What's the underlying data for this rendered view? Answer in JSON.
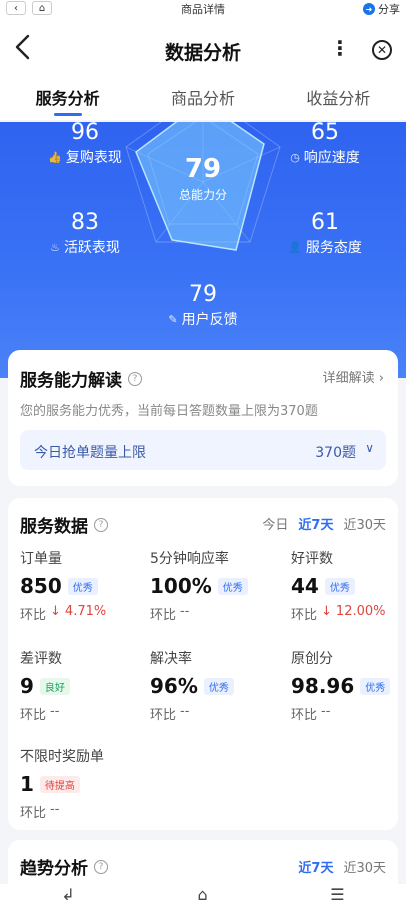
{
  "browser": {
    "title": "商品详情",
    "share_label": "分享",
    "back_icon": "chevron-left-icon",
    "home_icon": "home-icon"
  },
  "nav": {
    "title": "数据分析",
    "more": "⋮",
    "close": "✕"
  },
  "tabs": [
    {
      "label": "服务分析",
      "active": true
    },
    {
      "label": "商品分析",
      "active": false
    },
    {
      "label": "收益分析",
      "active": false
    }
  ],
  "radar": {
    "center": {
      "value": "79",
      "label": "总能力分"
    },
    "metrics": [
      {
        "value": "96",
        "label": "复购表现",
        "icon": "thumbs-up-icon"
      },
      {
        "value": "65",
        "label": "响应速度",
        "icon": "clock-icon"
      },
      {
        "value": "83",
        "label": "活跃表现",
        "icon": "flame-icon"
      },
      {
        "value": "61",
        "label": "服务态度",
        "icon": "person-icon"
      },
      {
        "value": "79",
        "label": "用户反馈",
        "icon": "edit-icon"
      }
    ]
  },
  "ability": {
    "title": "服务能力解读",
    "detail_link": "详细解读 ›",
    "description": "您的服务能力优秀，当前每日答题数量上限为370题",
    "limit_label": "今日抢单题量上限",
    "limit_value": "370题"
  },
  "service": {
    "title": "服务数据",
    "ranges": [
      "今日",
      "近7天",
      "近30天"
    ],
    "active_range": "近7天",
    "cmp_label": "环比",
    "items": [
      {
        "label": "订单量",
        "value": "850",
        "badge": "优秀",
        "badge_type": "blue",
        "cmp": "4.71%",
        "trend": "down"
      },
      {
        "label": "5分钟响应率",
        "value": "100%",
        "badge": "优秀",
        "badge_type": "blue",
        "cmp": "--",
        "trend": "none"
      },
      {
        "label": "好评数",
        "value": "44",
        "badge": "优秀",
        "badge_type": "blue",
        "cmp": "12.00%",
        "trend": "down"
      },
      {
        "label": "差评数",
        "value": "9",
        "badge": "良好",
        "badge_type": "green",
        "cmp": "--",
        "trend": "none"
      },
      {
        "label": "解决率",
        "value": "96%",
        "badge": "优秀",
        "badge_type": "blue",
        "cmp": "--",
        "trend": "none"
      },
      {
        "label": "原创分",
        "value": "98.96",
        "badge": "优秀",
        "badge_type": "blue",
        "cmp": "--",
        "trend": "none"
      },
      {
        "label": "不限时奖励单",
        "value": "1",
        "badge": "待提高",
        "badge_type": "red",
        "cmp": "--",
        "trend": "none"
      }
    ]
  },
  "trend": {
    "title": "趋势分析",
    "ranges": [
      "近7天",
      "近30天"
    ],
    "active_range": "近7天"
  },
  "bottom_bar": {
    "icons": [
      "back-icon",
      "home-icon",
      "menu-icon"
    ],
    "glyphs": [
      "↲",
      "⌂",
      "☰"
    ]
  }
}
